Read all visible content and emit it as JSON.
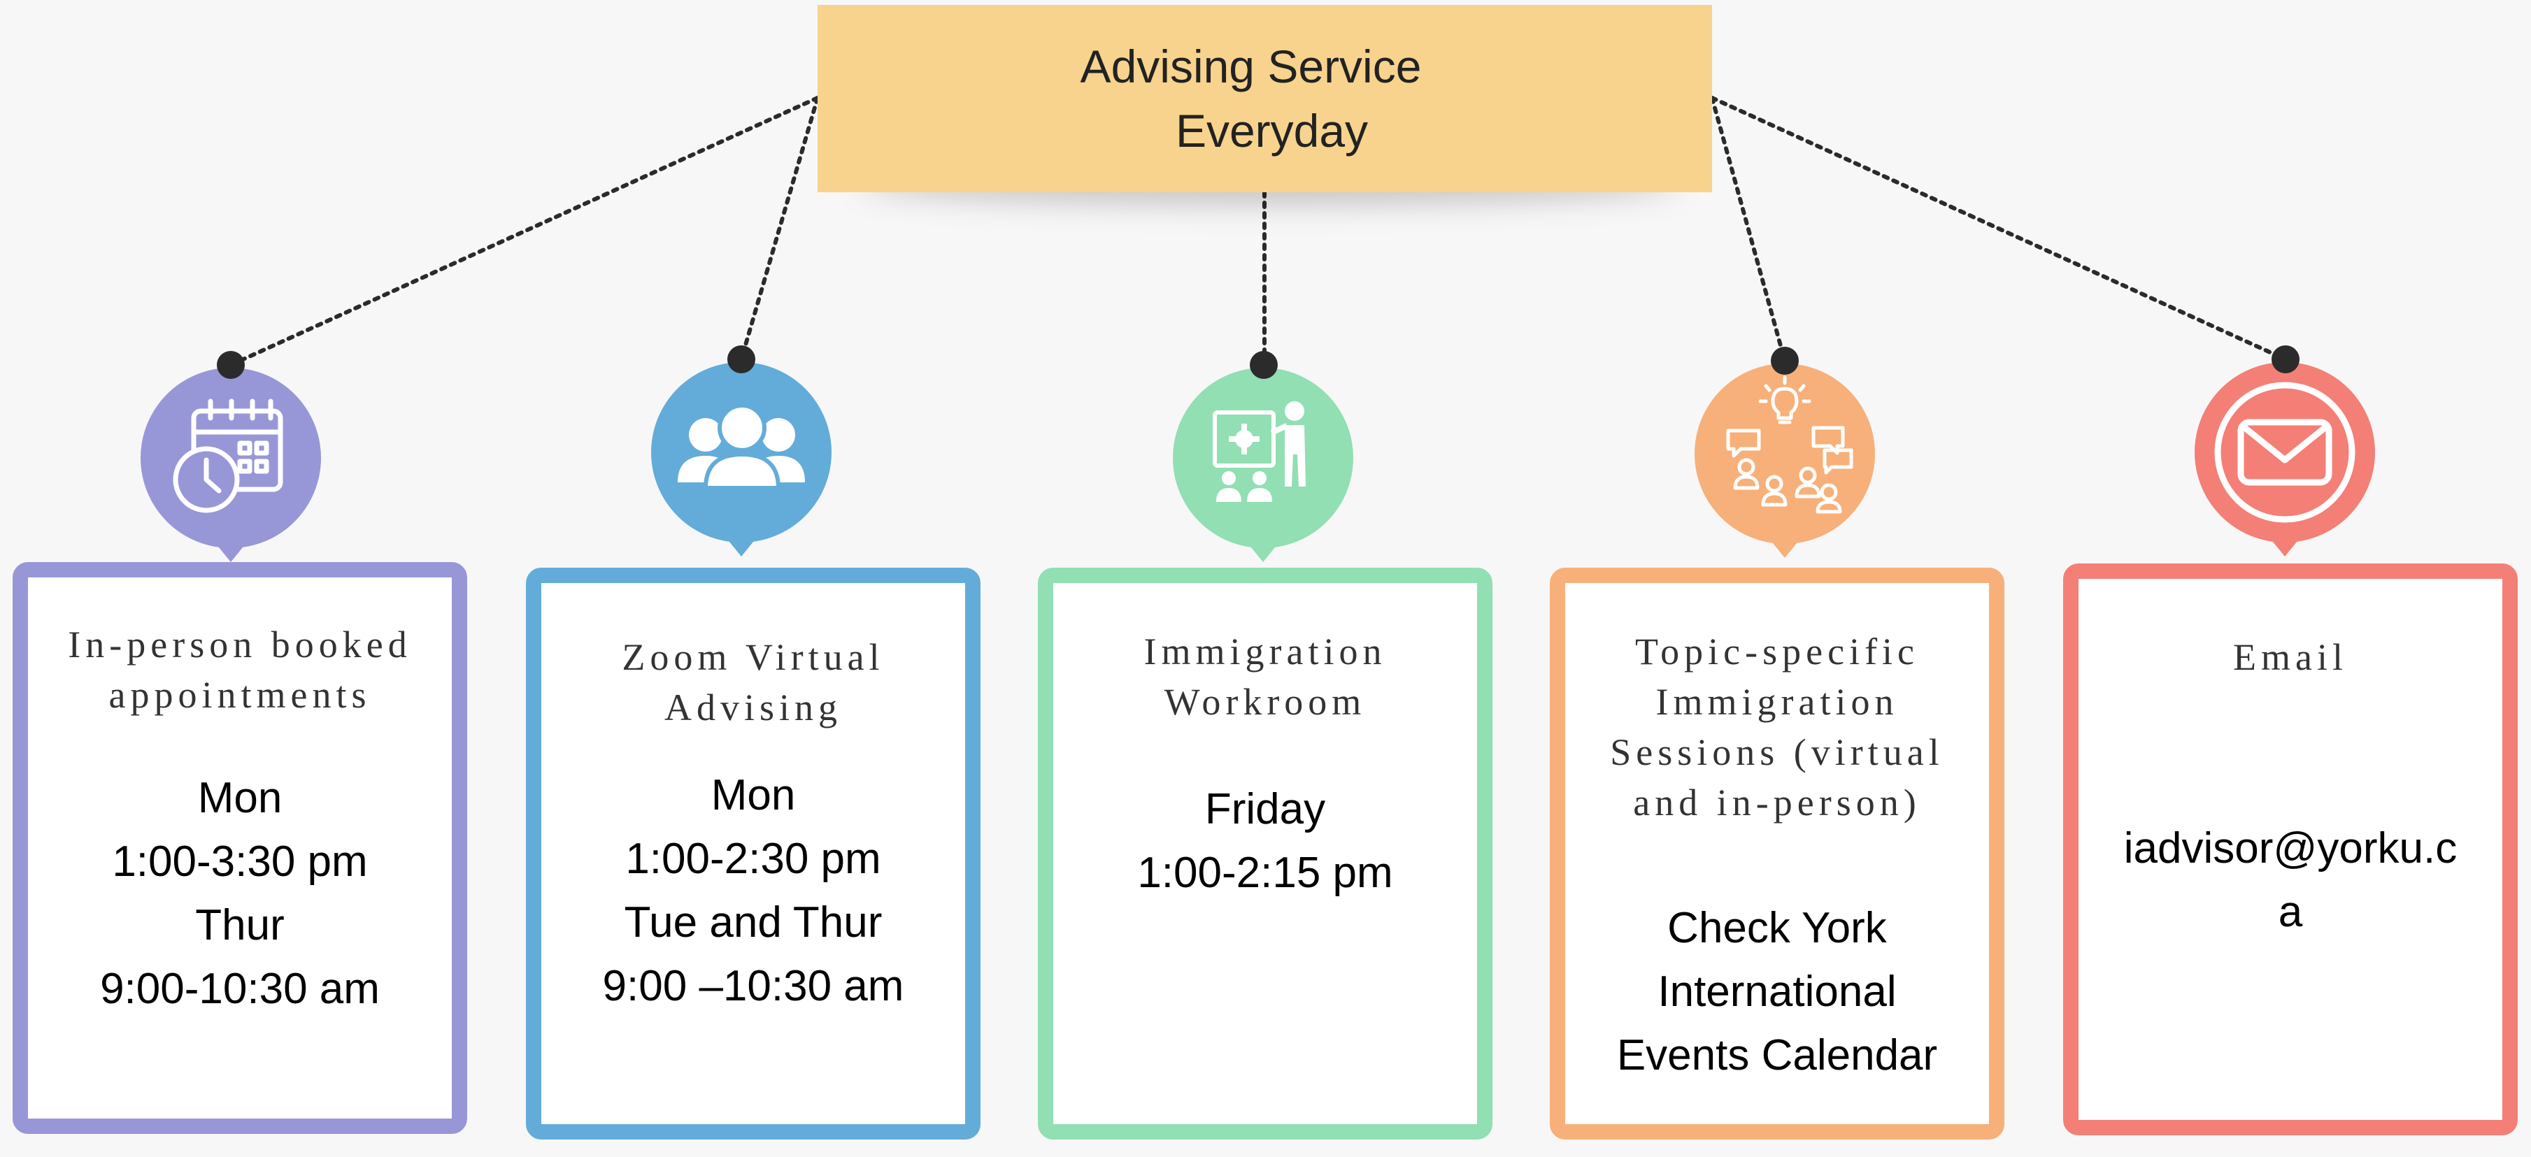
{
  "title": {
    "line1": "Advising Service",
    "line2": "Everyday"
  },
  "colors": {
    "title_bg": "#f8d38d",
    "purple": "#9797d8",
    "blue": "#63acd9",
    "green": "#91dfb3",
    "orange": "#f7b079",
    "red": "#f47f76",
    "connector": "#2b2b2b"
  },
  "services": [
    {
      "icon": "calendar-clock-icon",
      "title": "In-person booked\nappointments",
      "details": "Mon\n1:00-3:30 pm\nThur\n9:00-10:30 am"
    },
    {
      "icon": "group-people-icon",
      "title": "Zoom Virtual\nAdvising",
      "details": "Mon\n1:00-2:30 pm\nTue and Thur\n9:00 –10:30 am"
    },
    {
      "icon": "presentation-workshop-icon",
      "title": "Immigration\nWorkroom",
      "details": "Friday\n1:00-2:15 pm"
    },
    {
      "icon": "discussion-idea-icon",
      "title": "Topic-specific\nImmigration\nSessions (virtual\nand in-person)",
      "details": "Check York\nInternational\nEvents Calendar"
    },
    {
      "icon": "envelope-icon",
      "title": "Email",
      "details": "iadvisor@yorku.c\na"
    }
  ]
}
